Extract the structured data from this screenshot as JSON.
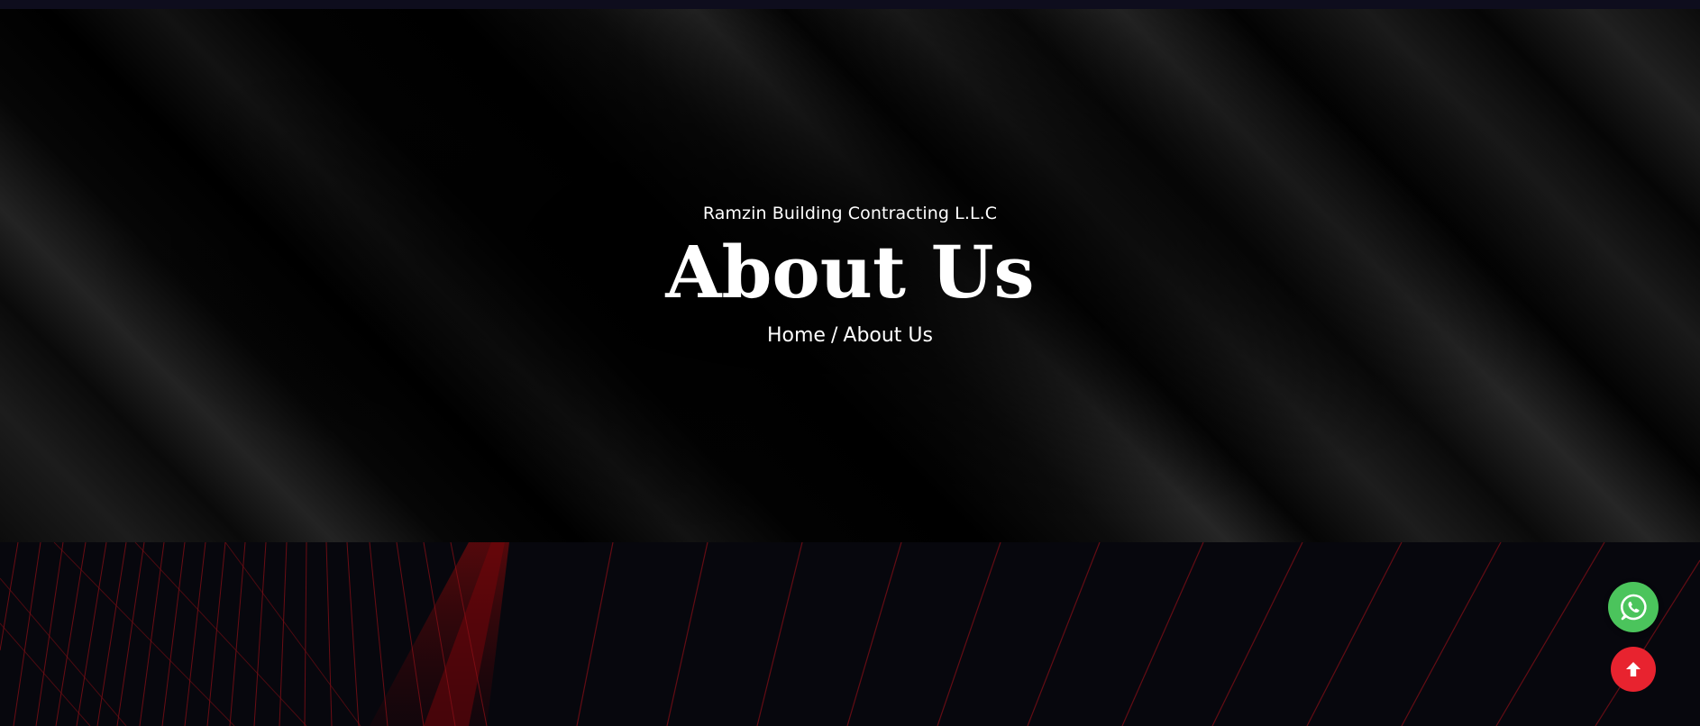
{
  "hero": {
    "subtitle": "Ramzin Building Contracting L.L.C",
    "title": "About Us",
    "breadcrumb": {
      "home": "Home",
      "separator": "/",
      "current": "About Us"
    }
  },
  "floating_buttons": {
    "whatsapp_icon": "whatsapp-icon",
    "scroll_top_icon": "arrow-up-icon"
  },
  "colors": {
    "accent_red": "#e8232f",
    "whatsapp_green": "#4bc45c",
    "line_red": "#b5121b"
  }
}
